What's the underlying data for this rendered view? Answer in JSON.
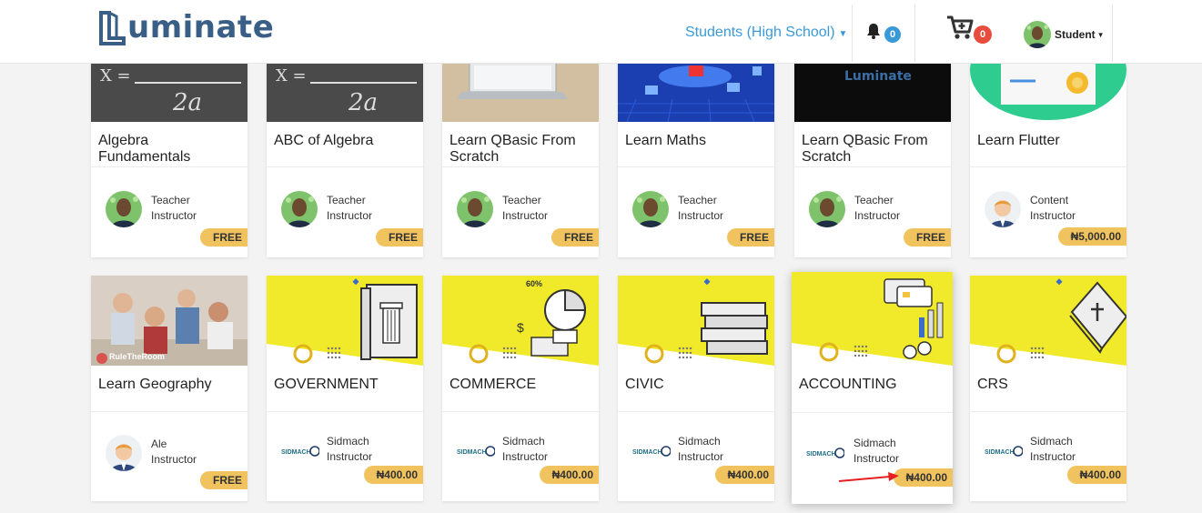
{
  "brand": {
    "name": "uminate",
    "logo_icon": "luminate-L-logo"
  },
  "nav": {
    "audience": "Students (High School)",
    "notifications_count": "0",
    "cart_count": "0",
    "user_label": "Student"
  },
  "colors": {
    "accent": "#3a9ad9",
    "price_badge": "#f1c35e",
    "cart_badge": "#e74c3c",
    "notif_badge": "#3a9ad9",
    "banner_yellow": "#f0ea2a"
  },
  "courses_row1": [
    {
      "title": "Algebra Fundamentals",
      "instructor": "Teacher",
      "role": "Instructor",
      "price": "FREE",
      "thumb": "chalkboard-formula"
    },
    {
      "title": "ABC of Algebra",
      "instructor": "Teacher",
      "role": "Instructor",
      "price": "FREE",
      "thumb": "chalkboard-formula"
    },
    {
      "title": "Learn QBasic From Scratch",
      "instructor": "Teacher",
      "role": "Instructor",
      "price": "FREE",
      "thumb": "laptop-on-desk"
    },
    {
      "title": "Learn Maths",
      "instructor": "Teacher",
      "role": "Instructor",
      "price": "FREE",
      "thumb": "cloud-icons-blue"
    },
    {
      "title": "Learn QBasic From Scratch",
      "instructor": "Teacher",
      "role": "Instructor",
      "price": "FREE",
      "thumb": "luminate-dark-banner",
      "thumb_text": "Luminate"
    },
    {
      "title": "Learn Flutter",
      "instructor": "Content",
      "role": "Instructor",
      "price": "₦5,000.00",
      "thumb": "certificate-green"
    }
  ],
  "courses_row2": [
    {
      "title": "Learn Geography",
      "instructor": "Ale",
      "role": "Instructor",
      "price": "FREE",
      "thumb": "students-photo",
      "thumb_text": "RuleTheRoom"
    },
    {
      "title": "GOVERNMENT",
      "instructor": "Sidmach",
      "role": "Instructor",
      "price": "₦400.00",
      "thumb": "yellow-pillar-book"
    },
    {
      "title": "COMMERCE",
      "instructor": "Sidmach",
      "role": "Instructor",
      "price": "₦400.00",
      "thumb": "yellow-piechart-money",
      "thumb_text": "60%"
    },
    {
      "title": "CIVIC",
      "instructor": "Sidmach",
      "role": "Instructor",
      "price": "₦400.00",
      "thumb": "yellow-books-stack"
    },
    {
      "title": "ACCOUNTING",
      "instructor": "Sidmach",
      "role": "Instructor",
      "price": "₦400.00",
      "thumb": "yellow-cards-coins"
    },
    {
      "title": "CRS",
      "instructor": "Sidmach",
      "role": "Instructor",
      "price": "₦400.00",
      "thumb": "yellow-bible"
    }
  ]
}
